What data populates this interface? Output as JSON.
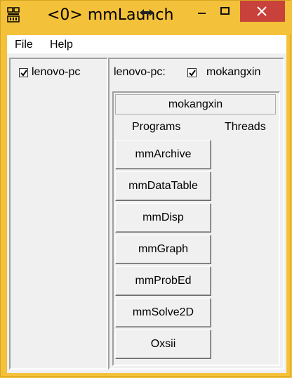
{
  "window": {
    "title": "<0> mmLaunch",
    "titlebar_color": "#f3c13a",
    "close_button_color": "#c9413b",
    "icons": [
      "app-icon",
      "move-icon",
      "minimize-icon",
      "maximize-icon",
      "close-icon"
    ]
  },
  "menu": {
    "items": [
      "File",
      "Help"
    ]
  },
  "hosts_panel": {
    "host_label": "lenovo-pc",
    "host_checked": true
  },
  "session_panel": {
    "host_label": "lenovo-pc:",
    "user_label": "mokangxin",
    "user_checked": true,
    "user_header": "mokangxin",
    "columns": {
      "programs": "Programs",
      "threads": "Threads"
    },
    "programs": [
      "mmArchive",
      "mmDataTable",
      "mmDisp",
      "mmGraph",
      "mmProbEd",
      "mmSolve2D",
      "Oxsii"
    ]
  }
}
